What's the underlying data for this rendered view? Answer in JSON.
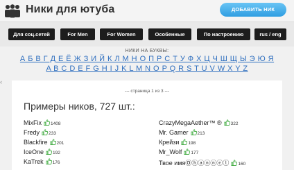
{
  "header": {
    "site_title": "Ники для ютуба",
    "add_button": "ДОБАВИТЬ НИК",
    "logo_icon": "people-icon",
    "accent": "#2f9ee2"
  },
  "categories": [
    "Для соц.сетей",
    "For Men",
    "For Women",
    "Особенные",
    "По настроению",
    "rus / eng"
  ],
  "alphabet": {
    "title": "НИКИ НА БУКВЫ:",
    "russian": "А Б В Г Д Е Ё Ж З И Й К Л М Н О П Р С Т У Ф Х Ц Ч Ш Щ Ы Э Ю Я",
    "english": "A B C D E F G H I J K L M N O P Q R S T U V W X Y Z",
    "link_color": "#2f6fbf"
  },
  "main": {
    "page_info": "--- страница 1 из 3 ---",
    "heading": "Примеры ников, 727 шт.:",
    "nicks": [
      {
        "name": "MixFix",
        "likes": "1408"
      },
      {
        "name": "CrazyMegaAether™ ®",
        "likes": "322"
      },
      {
        "name": "Fredy",
        "likes": "233"
      },
      {
        "name": "Mr. Gamer",
        "likes": "213"
      },
      {
        "name": "Blackfire",
        "likes": "201"
      },
      {
        "name": "Крейзи",
        "likes": "198"
      },
      {
        "name": "IceOne",
        "likes": "192"
      },
      {
        "name": "Mr_Wolf",
        "likes": "177"
      },
      {
        "name": "KaTrek",
        "likes": "176"
      },
      {
        "name": "Твое имяⓄⓗⓐⓝⓝⓔⓛ",
        "likes": "160"
      }
    ],
    "like_icon": "thumbs-up-icon",
    "like_color": "#3aa83a"
  }
}
